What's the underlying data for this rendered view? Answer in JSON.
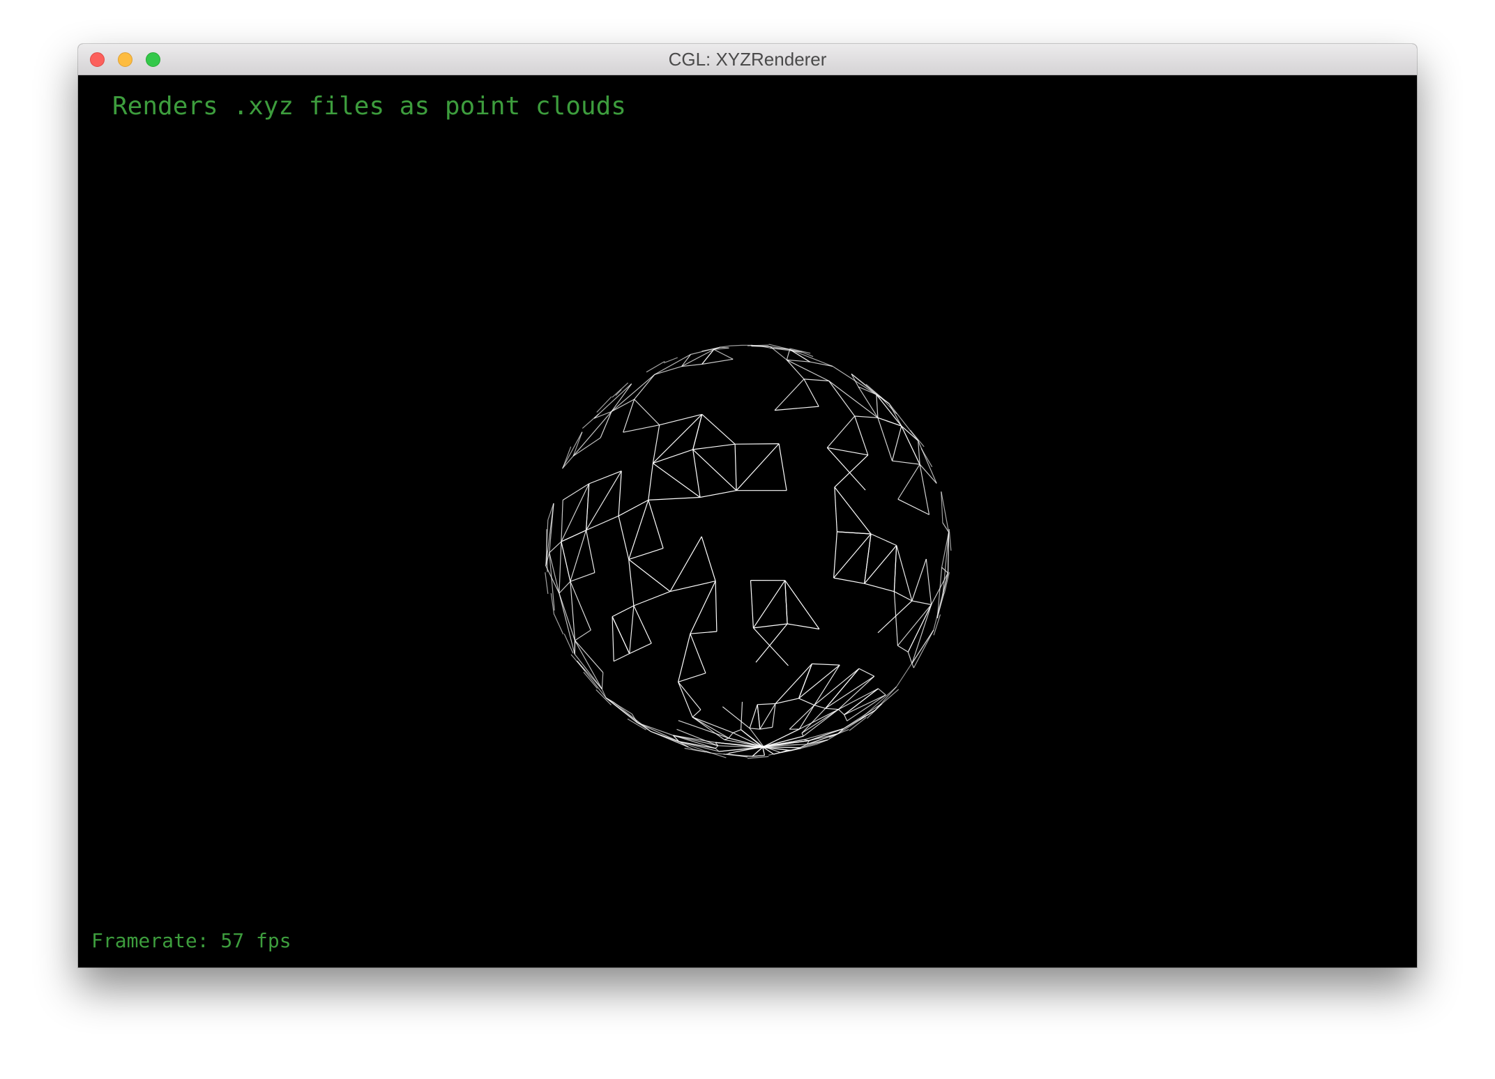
{
  "window": {
    "title": "CGL: XYZRenderer"
  },
  "canvas": {
    "heading": "Renders .xyz files as point clouds",
    "framerate_label": "Framerate: 57 fps"
  },
  "colors": {
    "overlay_text": "#3d9d3d",
    "background": "#000000",
    "wireframe": "#ffffff"
  }
}
